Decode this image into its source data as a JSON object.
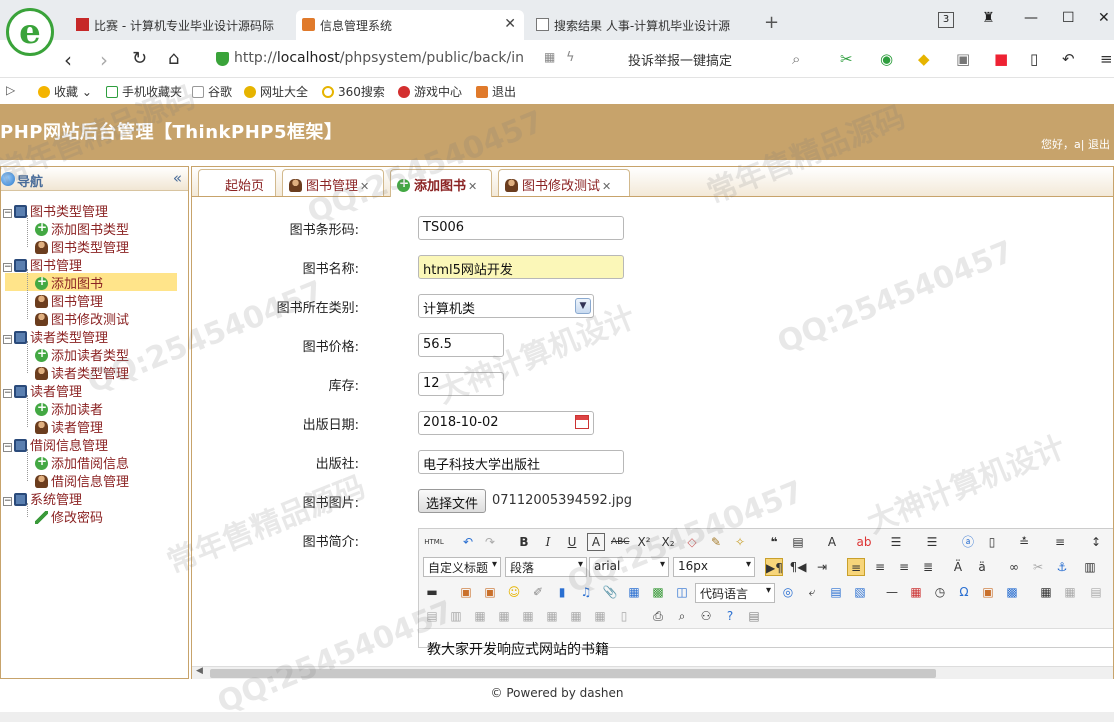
{
  "browser": {
    "tabs": [
      {
        "title": "比赛 - 计算机专业毕业设计源码际",
        "active": false
      },
      {
        "title": "信息管理系统",
        "active": true
      },
      {
        "title": "搜索结果 人事-计算机毕业设计源",
        "active": false
      }
    ],
    "new_tab": "+",
    "tab_count": "3",
    "url_prefix": "http://",
    "url_host": "localhost",
    "url_path": "/phpsystem/public/back/in",
    "report_text": "投诉举报一键搞定",
    "bookmarks": [
      "收藏",
      "手机收藏夹",
      "谷歌",
      "网址大全",
      "360搜索",
      "游戏中心",
      "退出"
    ]
  },
  "header": {
    "title": "PHP网站后台管理【ThinkPHP5框架】",
    "greeting": "您好，a| 退出"
  },
  "sidebar": {
    "title": "导航",
    "collapse_icon": "«",
    "groups": [
      {
        "label": "图书类型管理",
        "items": [
          {
            "label": "添加图书类型",
            "icon": "add"
          },
          {
            "label": "图书类型管理",
            "icon": "user"
          }
        ]
      },
      {
        "label": "图书管理",
        "items": [
          {
            "label": "添加图书",
            "icon": "add"
          },
          {
            "label": "图书管理",
            "icon": "user"
          },
          {
            "label": "图书修改测试",
            "icon": "user"
          }
        ]
      },
      {
        "label": "读者类型管理",
        "items": [
          {
            "label": "添加读者类型",
            "icon": "add"
          },
          {
            "label": "读者类型管理",
            "icon": "user"
          }
        ]
      },
      {
        "label": "读者管理",
        "items": [
          {
            "label": "添加读者",
            "icon": "add"
          },
          {
            "label": "读者管理",
            "icon": "user"
          }
        ]
      },
      {
        "label": "借阅信息管理",
        "items": [
          {
            "label": "添加借阅信息",
            "icon": "add"
          },
          {
            "label": "借阅信息管理",
            "icon": "user"
          }
        ]
      },
      {
        "label": "系统管理",
        "items": [
          {
            "label": "修改密码",
            "icon": "pen"
          }
        ]
      }
    ],
    "selected": "添加图书"
  },
  "content_tabs": [
    {
      "label": "起始页",
      "closable": false
    },
    {
      "label": "图书管理",
      "closable": true
    },
    {
      "label": "添加图书",
      "closable": true,
      "active": true
    },
    {
      "label": "图书修改测试",
      "closable": true
    }
  ],
  "form": {
    "barcode": {
      "label": "图书条形码:",
      "value": "TS006"
    },
    "name": {
      "label": "图书名称:",
      "value": "html5网站开发"
    },
    "category": {
      "label": "图书所在类别:",
      "value": "计算机类"
    },
    "price": {
      "label": "图书价格:",
      "value": "56.5"
    },
    "stock": {
      "label": "库存:",
      "value": "12"
    },
    "publish_date": {
      "label": "出版日期:",
      "value": "2018-10-02"
    },
    "publisher": {
      "label": "出版社:",
      "value": "电子科技大学出版社"
    },
    "image": {
      "label": "图书图片:",
      "button": "选择文件",
      "filename": "07112005394592.jpg"
    },
    "intro": {
      "label": "图书简介:",
      "content": "教大家开发响应式网站的书籍"
    }
  },
  "editor": {
    "selects": {
      "custom_title": "自定义标题",
      "paragraph": "段落",
      "font": "arial",
      "size": "16px",
      "code_lang": "代码语言"
    },
    "source_button": "HTML"
  },
  "footer": {
    "text": "© Powered by dashen"
  },
  "watermarks": [
    "常年售精品源码",
    "QQ:254540457",
    "大神计算机设计"
  ]
}
